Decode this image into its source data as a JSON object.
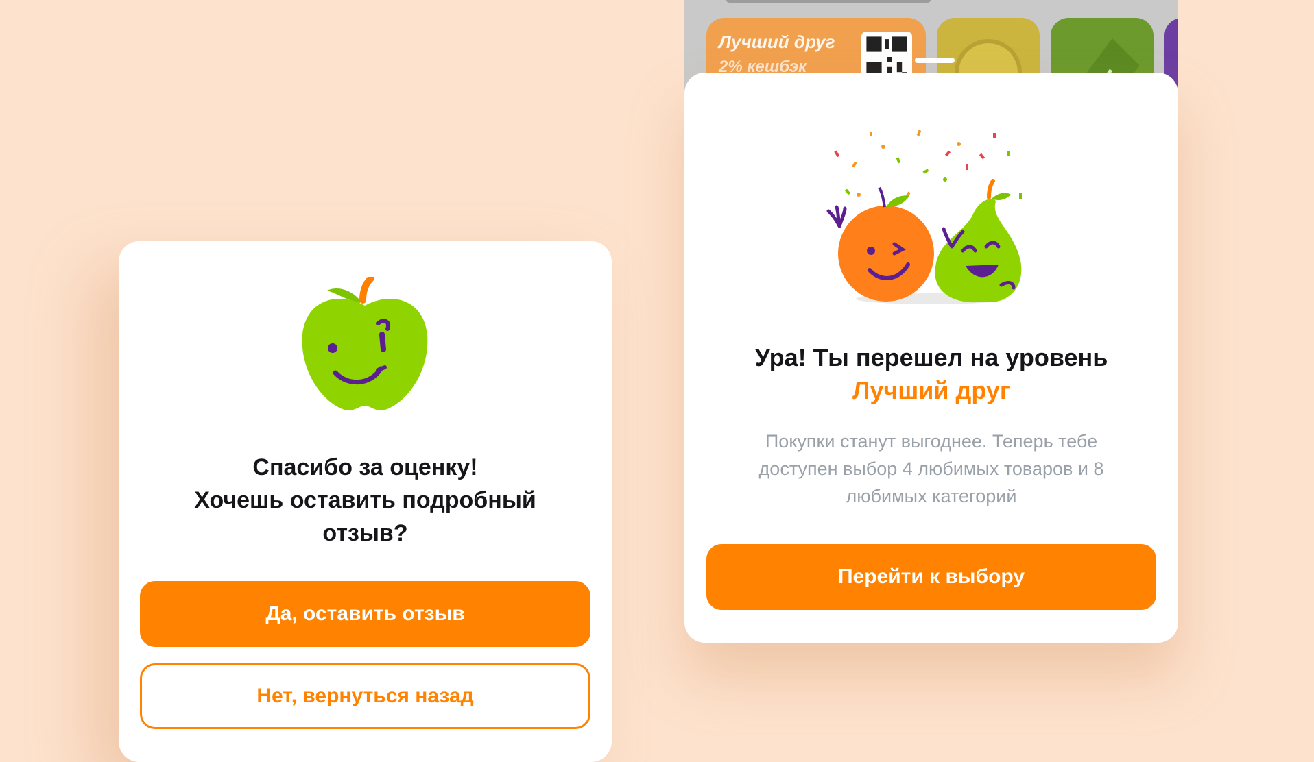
{
  "colors": {
    "background": "#fde2cd",
    "accent": "#ff8200",
    "title": "#16161a",
    "muted": "#9aa0a8",
    "apple_green": "#8fd400",
    "face_purple": "#5b1f91"
  },
  "left_dialog": {
    "title_line1": "Спасибо за оценку!",
    "title_line2": "Хочешь оставить подробный",
    "title_line3": "отзыв?",
    "primary_button": "Да, оставить отзыв",
    "secondary_button": "Нет, вернуться назад",
    "illustration_icon": "smiling-apple-icon"
  },
  "app_peek": {
    "tile_label": "Лучший друг",
    "tile_sub": "2% кешбэк",
    "qr_icon": "qr-code-icon"
  },
  "right_dialog": {
    "title": "Ура! Ты перешел на уровень",
    "title_accent": "Лучший друг",
    "description": "Покупки станут выгоднее. Теперь тебе доступен выбор 4 любимых товаров и 8 любимых категорий",
    "primary_button": "Перейти к выбору",
    "illustration_icon": "orange-and-pear-celebration-icon"
  }
}
